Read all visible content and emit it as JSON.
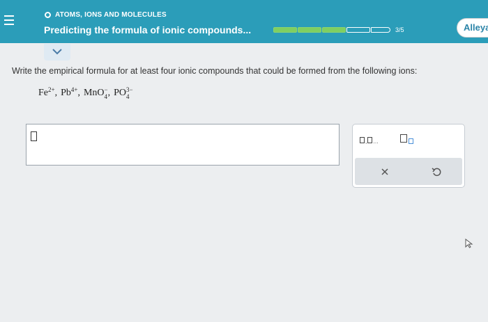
{
  "header": {
    "topic": "ATOMS, IONS AND MOLECULES",
    "title": "Predicting the formula of ionic compounds...",
    "progress_label": "3/5",
    "progress_fraction": 0.6,
    "user_name": "Alleya"
  },
  "question": {
    "instruction": "Write the empirical formula for at least four ionic compounds that could be formed from the following ions:",
    "ions": [
      {
        "base": "Fe",
        "sub": "",
        "charge": "2+",
        "sep": ","
      },
      {
        "base": "Pb",
        "sub": "",
        "charge": "4+",
        "sep": ","
      },
      {
        "base": "MnO",
        "sub": "4",
        "charge": "−",
        "sep": ","
      },
      {
        "base": "PO",
        "sub": "4",
        "charge": "3−",
        "sep": ""
      }
    ]
  },
  "answer": {
    "value": ""
  },
  "toolbar": {
    "top_tools": [
      "list-icon",
      "subscript-icon"
    ],
    "bottom_tools": [
      "close-icon",
      "undo-icon"
    ]
  },
  "colors": {
    "header_bg": "#2b9db9",
    "progress_filled": "#7fcf61",
    "user_text": "#2b84a8"
  }
}
